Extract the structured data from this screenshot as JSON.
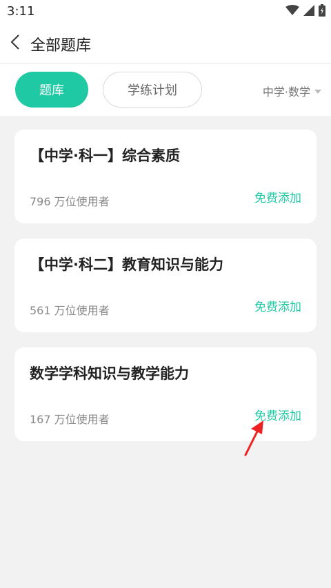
{
  "status_bar": {
    "time": "3:11"
  },
  "header": {
    "title": "全部题库"
  },
  "tabs": [
    {
      "label": "题库",
      "active": true
    },
    {
      "label": "学练计划",
      "active": false
    }
  ],
  "category": {
    "selected": "中学·数学"
  },
  "cards": [
    {
      "title": "【中学·科一】综合素质",
      "users": "796 万位使用者",
      "action": "免费添加"
    },
    {
      "title": "【中学·科二】教育知识与能力",
      "users": "561 万位使用者",
      "action": "免费添加"
    },
    {
      "title": "数学学科知识与教学能力",
      "users": "167 万位使用者",
      "action": "免费添加"
    }
  ],
  "colors": {
    "accent": "#1ec9a4",
    "annotation": "#ee2222"
  },
  "icons": [
    "wifi-icon",
    "signal-icon",
    "battery-icon",
    "back-arrow-icon",
    "chevron-down-icon",
    "red-arrow-annotation"
  ]
}
